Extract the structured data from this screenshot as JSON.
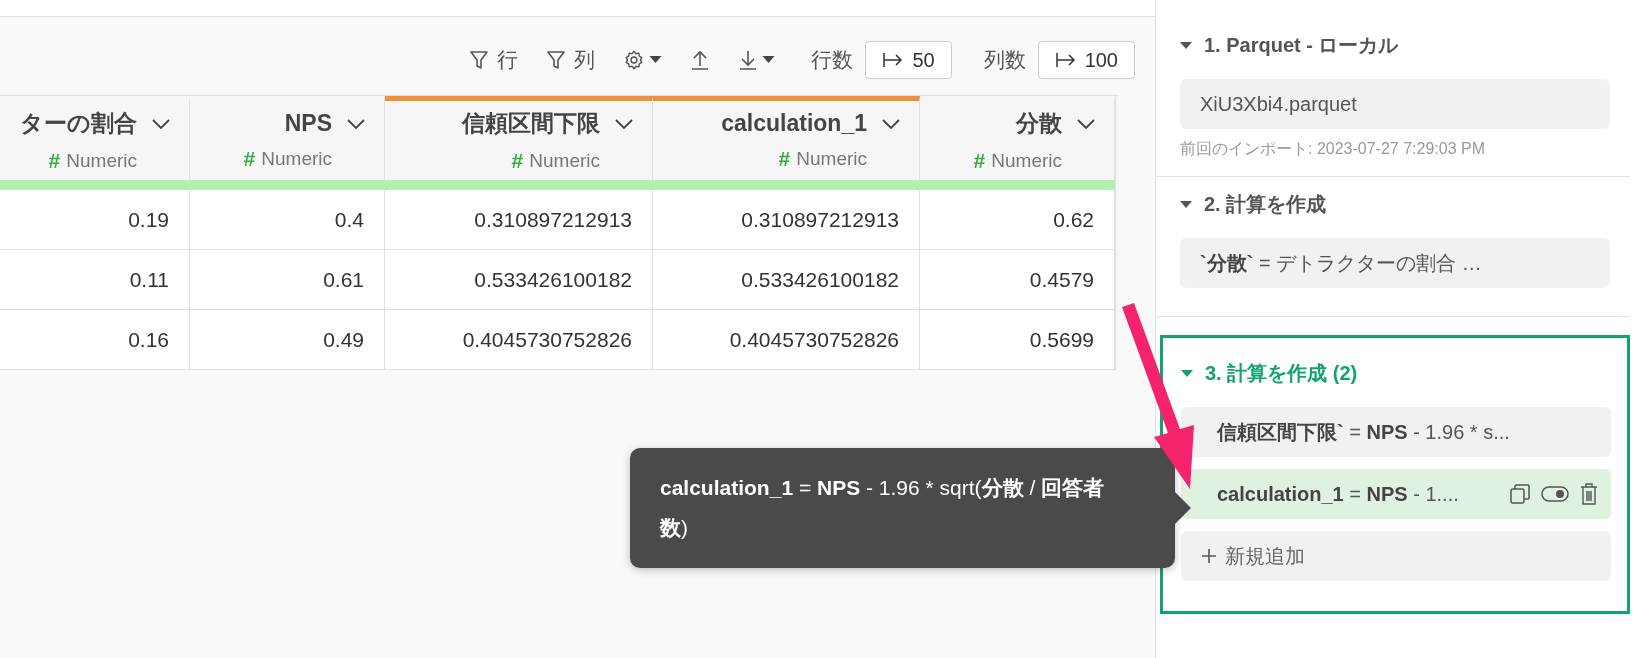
{
  "toolbar": {
    "row_filter": "行",
    "column_filter": "列",
    "row_count_label": "行数",
    "row_count": "50",
    "column_count_label": "列数",
    "column_count": "100"
  },
  "table": {
    "columns": [
      {
        "name": "ターの割合",
        "type_icon": "#",
        "type": "Numeric",
        "highlighted": false
      },
      {
        "name": "NPS",
        "type_icon": "#",
        "type": "Numeric",
        "highlighted": false
      },
      {
        "name": "信頼区間下限",
        "type_icon": "#",
        "type": "Numeric",
        "highlighted": true
      },
      {
        "name": "calculation_1",
        "type_icon": "#",
        "type": "Numeric",
        "highlighted": true
      },
      {
        "name": "分散",
        "type_icon": "#",
        "type": "Numeric",
        "highlighted": false
      }
    ],
    "rows": [
      [
        "0.19",
        "0.4",
        "0.310897212913",
        "0.310897212913",
        "0.62"
      ],
      [
        "0.11",
        "0.61",
        "0.533426100182",
        "0.533426100182",
        "0.4579"
      ],
      [
        "0.16",
        "0.49",
        "0.4045730752826",
        "0.4045730752826",
        "0.5699"
      ]
    ]
  },
  "tooltip": "**calculation_1** = **NPS** - 1.96 * sqrt(**分散** / **回答者数**)",
  "steps": [
    {
      "title": "1. Parquet - ローカル",
      "active": false,
      "expanded": true,
      "items": [
        {
          "text": "XiU3Xbi4.parquet",
          "selected": false
        }
      ],
      "note": "前回のインポート: 2023-07-27 7:29:03 PM"
    },
    {
      "title": "2. 計算を作成",
      "active": false,
      "expanded": true,
      "items": [
        {
          "text": "**`分散`** = デトラクターの割合 …",
          "selected": false
        }
      ]
    },
    {
      "title": "3. 計算を作成 (2)",
      "active": true,
      "expanded": true,
      "items": [
        {
          "text": "**信頼区間下限`** = **NPS** - 1.96 * s...",
          "selected": false
        },
        {
          "text": "**calculation_1** = **NPS** - 1....",
          "selected": true
        }
      ],
      "add_label": "新規追加"
    }
  ]
}
